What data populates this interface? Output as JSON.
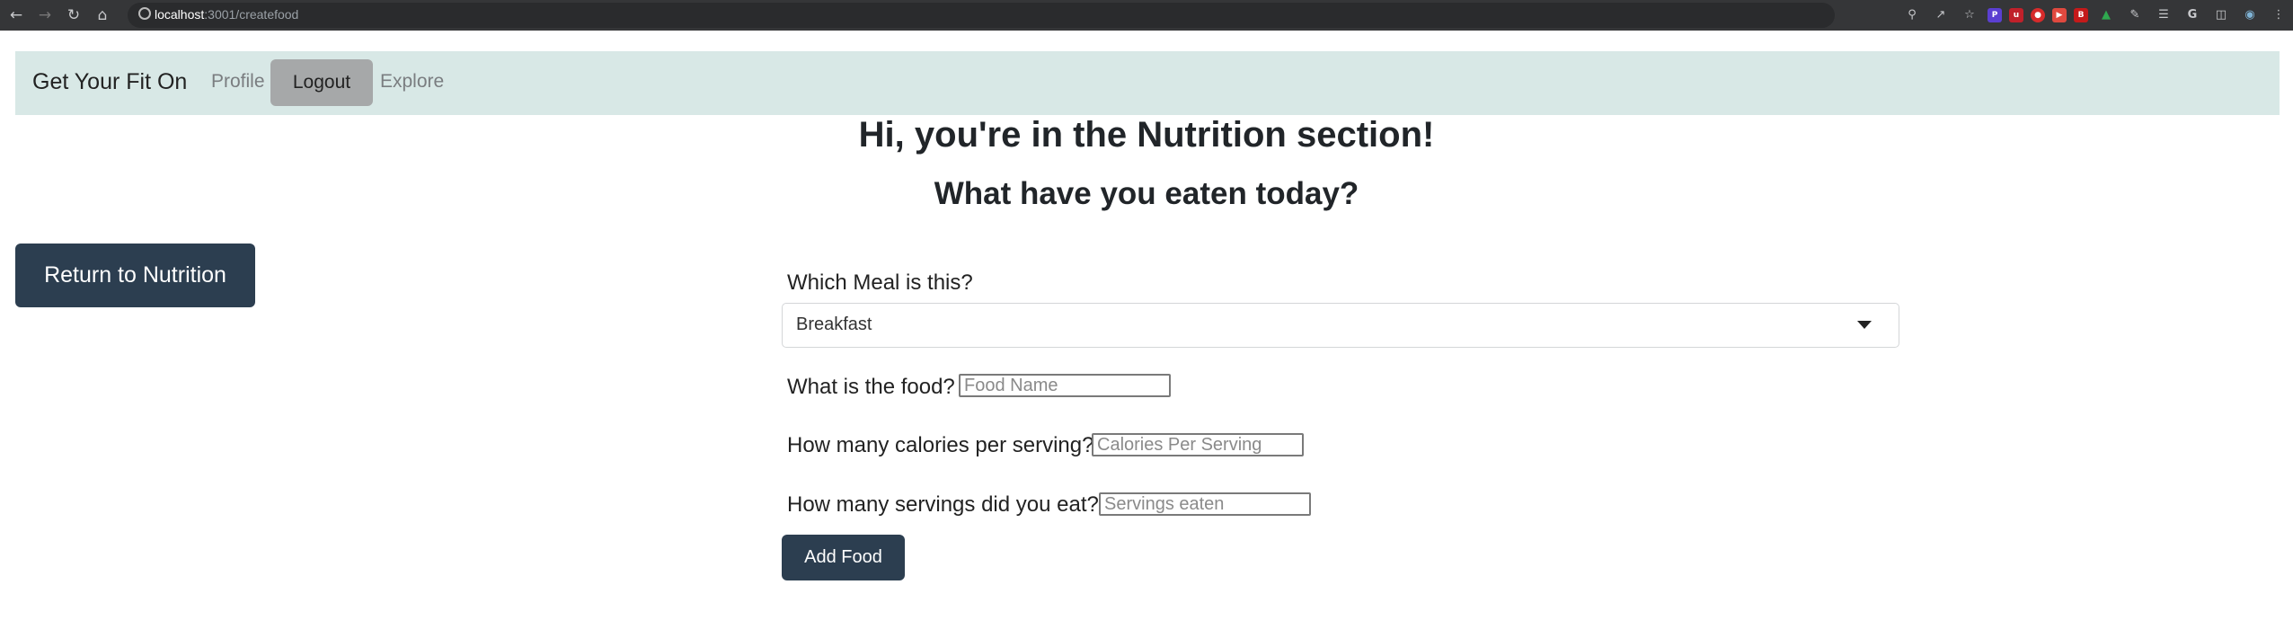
{
  "browser": {
    "url_host": "localhost",
    "url_path": ":3001/createfood",
    "icons": [
      "back-icon",
      "forward-icon",
      "reload-icon",
      "home-icon"
    ]
  },
  "navbar": {
    "brand": "Get Your Fit On",
    "profile": "Profile",
    "logout": "Logout",
    "explore": "Explore"
  },
  "page": {
    "title": "Hi, you're in the Nutrition section!",
    "subtitle": "What have you eaten today?",
    "return_button": "Return to Nutrition"
  },
  "form": {
    "meal_label": "Which Meal is this?",
    "meal_value": "Breakfast",
    "food_label": "What is the food?",
    "food_placeholder": "Food Name",
    "calories_label": "How many calories per serving?",
    "calories_placeholder": "Calories Per Serving",
    "servings_label": "How many servings did you eat?",
    "servings_placeholder": "Servings eaten",
    "submit": "Add Food"
  },
  "colors": {
    "navbar_bg": "#d8e8e6",
    "primary_button": "#2c3e50",
    "logout_bg": "#a6a8a9"
  }
}
